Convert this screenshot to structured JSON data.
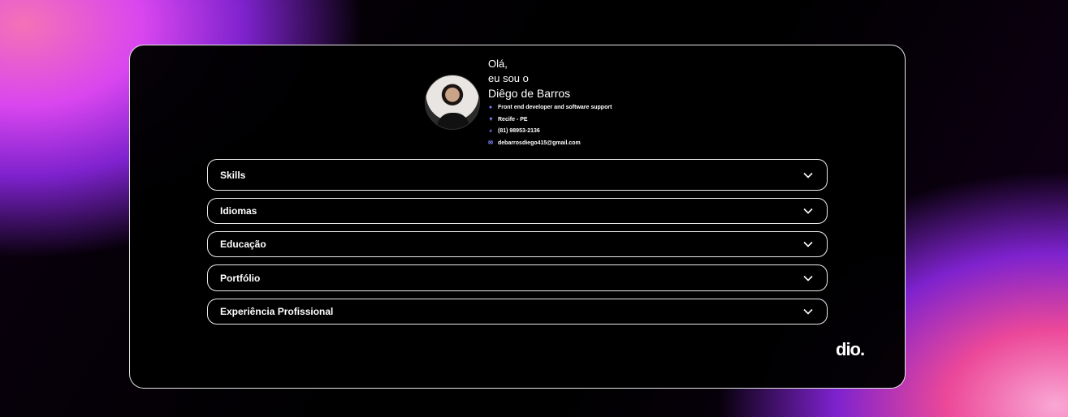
{
  "profile": {
    "greeting_line1": "Olá,",
    "greeting_line2": "eu sou o",
    "name": "Diêgo de Barros",
    "info": [
      {
        "icon": "person-icon",
        "text": "Front end developer and software support"
      },
      {
        "icon": "location-pin-icon",
        "text": "Recife - PE"
      },
      {
        "icon": "whatsapp-icon",
        "text": "(81) 98953-2136"
      },
      {
        "icon": "mail-icon",
        "text": "debarrosdiego415@gmail.com"
      }
    ]
  },
  "sections": [
    {
      "label": "Skills"
    },
    {
      "label": "Idiomas"
    },
    {
      "label": "Educação"
    },
    {
      "label": "Portfólio"
    },
    {
      "label": "Experiência Profissional"
    }
  ],
  "brand": {
    "logo_text": "dio."
  },
  "colors": {
    "icon_accent": "#7c83ff",
    "border": "#ffffff",
    "gradient_pink": "#ec4899",
    "gradient_purple": "#7e22ce"
  }
}
